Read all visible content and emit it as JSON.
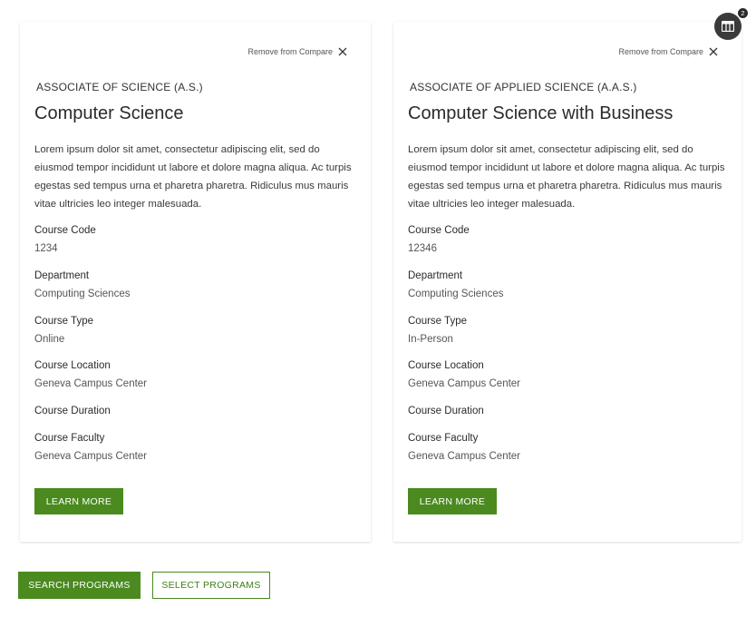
{
  "compare": {
    "badge_count": "2",
    "icon": "table-icon"
  },
  "cards": [
    {
      "remove_label": "Remove from Compare",
      "degree": "ASSOCIATE OF SCIENCE (A.S.)",
      "title": "Computer Science",
      "description": "Lorem ipsum dolor sit amet, consectetur adipiscing elit, sed do eiusmod tempor incididunt ut labore et dolore magna aliqua. Ac turpis egestas sed tempus urna et pharetra pharetra. Ridiculus mus mauris vitae ultricies leo integer malesuada.",
      "fields": {
        "code_label": "Course Code",
        "code_value": "1234",
        "department_label": "Department",
        "department_value": "Computing Sciences",
        "type_label": "Course Type",
        "type_value": "Online",
        "location_label": "Course Location",
        "location_value": "Geneva Campus Center",
        "duration_label": "Course Duration",
        "duration_value": "",
        "faculty_label": "Course Faculty",
        "faculty_value": "Geneva Campus Center"
      },
      "learn_more": "LEARN MORE"
    },
    {
      "remove_label": "Remove from Compare",
      "degree": "ASSOCIATE OF APPLIED SCIENCE (A.A.S.)",
      "title": "Computer Science with Business",
      "description": "Lorem ipsum dolor sit amet, consectetur adipiscing elit, sed do eiusmod tempor incididunt ut labore et dolore magna aliqua. Ac turpis egestas sed tempus urna et pharetra pharetra. Ridiculus mus mauris vitae ultricies leo integer malesuada.",
      "fields": {
        "code_label": "Course Code",
        "code_value": "12346",
        "department_label": "Department",
        "department_value": "Computing Sciences",
        "type_label": "Course Type",
        "type_value": "In-Person",
        "location_label": "Course Location",
        "location_value": "Geneva Campus Center",
        "duration_label": "Course Duration",
        "duration_value": "",
        "faculty_label": "Course Faculty",
        "faculty_value": "Geneva Campus Center"
      },
      "learn_more": "LEARN MORE"
    }
  ],
  "actions": {
    "search_programs": "SEARCH PROGRAMS",
    "select_programs": "SELECT PROGRAMS"
  },
  "colors": {
    "accent_green": "#4a8a1f",
    "fab_dark": "#3a3a3a"
  }
}
